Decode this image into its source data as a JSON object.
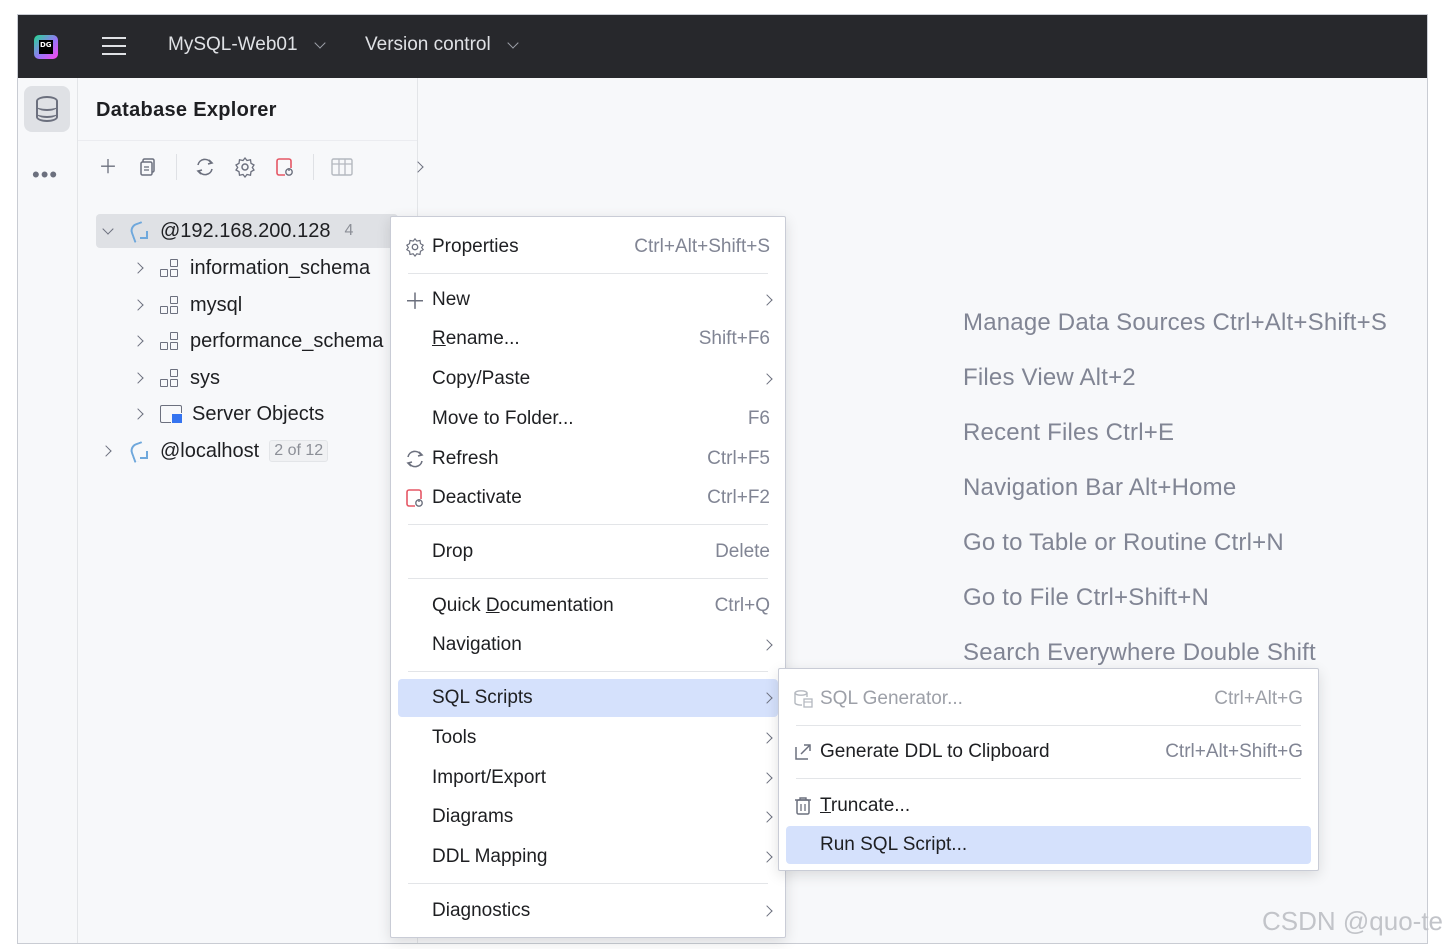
{
  "titlebar": {
    "logo_text": "DG",
    "project": "MySQL-Web01",
    "vcs": "Version control"
  },
  "explorer": {
    "title": "Database Explorer",
    "tree": [
      {
        "label": "@192.168.200.128",
        "badge": "4",
        "expanded": true,
        "selected": true
      },
      {
        "label": "information_schema"
      },
      {
        "label": "mysql"
      },
      {
        "label": "performance_schema"
      },
      {
        "label": "sys"
      },
      {
        "label": "Server Objects"
      },
      {
        "label": "@localhost",
        "badge": "2 of 12",
        "expanded": false
      }
    ]
  },
  "hints": [
    "Manage Data Sources Ctrl+Alt+Shift+S",
    "Files View Alt+2",
    "Recent Files Ctrl+E",
    "Navigation Bar Alt+Home",
    "Go to Table or Routine Ctrl+N",
    "Go to File Ctrl+Shift+N",
    "Search Everywhere Double Shift"
  ],
  "context_menu": {
    "items": [
      {
        "label": "Properties",
        "shortcut": "Ctrl+Alt+Shift+S"
      },
      {
        "label": "New"
      },
      {
        "label_pre": "",
        "label_u": "R",
        "label_post": "ename...",
        "shortcut": "Shift+F6"
      },
      {
        "label": "Copy/Paste"
      },
      {
        "label": "Move to Folder...",
        "shortcut": "F6"
      },
      {
        "label": "Refresh",
        "shortcut": "Ctrl+F5"
      },
      {
        "label": "Deactivate",
        "shortcut": "Ctrl+F2"
      },
      {
        "label": "Drop",
        "shortcut": "Delete"
      },
      {
        "label_pre": "Quick ",
        "label_u": "D",
        "label_post": "ocumentation",
        "shortcut": "Ctrl+Q"
      },
      {
        "label": "Navigation"
      },
      {
        "label": "SQL Scripts",
        "active": true
      },
      {
        "label": "Tools"
      },
      {
        "label": "Import/Export"
      },
      {
        "label": "Diagrams"
      },
      {
        "label": "DDL Mapping"
      },
      {
        "label": "Diagnostics"
      }
    ]
  },
  "submenu": {
    "items": [
      {
        "label": "SQL Generator...",
        "shortcut": "Ctrl+Alt+G",
        "disabled": true
      },
      {
        "label": "Generate DDL to Clipboard",
        "shortcut": "Ctrl+Alt+Shift+G"
      },
      {
        "label_pre": "",
        "label_u": "T",
        "label_post": "runcate..."
      },
      {
        "label": "Run SQL Script...",
        "active": true
      }
    ]
  },
  "watermark": "CSDN @quo-te",
  "colors": {
    "titlebar_bg": "#27282c",
    "menu_active": "#d5e1fc",
    "accent_red": "#e55765",
    "hint_text": "#818594"
  }
}
